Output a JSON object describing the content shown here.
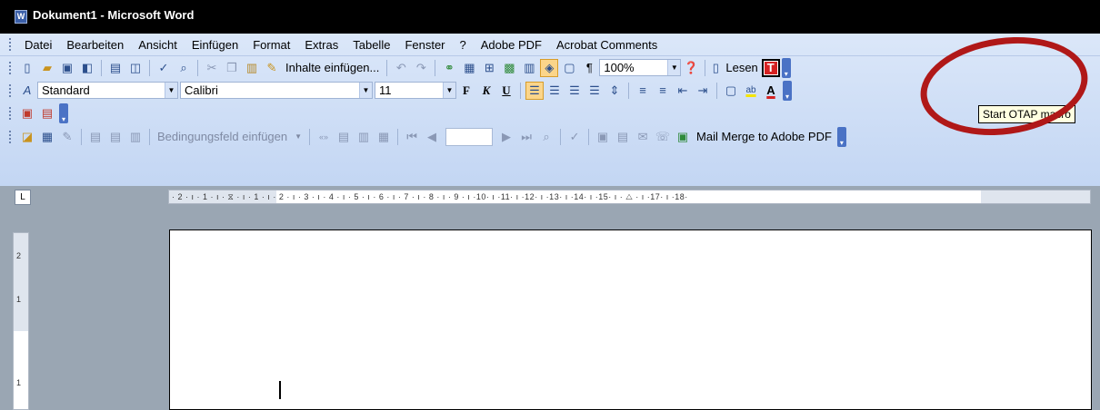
{
  "window": {
    "title": "Dokument1 - Microsoft Word",
    "icon": "word-doc-icon"
  },
  "menu": [
    "Datei",
    "Bearbeiten",
    "Ansicht",
    "Einfügen",
    "Format",
    "Extras",
    "Tabelle",
    "Fenster",
    "?",
    "Adobe PDF",
    "Acrobat Comments"
  ],
  "standard_toolbar": {
    "paste_special_label": "Inhalte einfügen...",
    "zoom_value": "100%",
    "read_label": "Lesen",
    "start_macro_icon": "T"
  },
  "formatting_toolbar": {
    "style_value": "Standard",
    "font_value": "Calibri",
    "size_value": "11",
    "bold": "F",
    "italic": "K",
    "underline": "U",
    "highlight_label": "ab",
    "font_color_label": "A"
  },
  "mailmerge_toolbar": {
    "insert_condition_label": "Bedingungsfeld einfügen",
    "mail_merge_pdf_label": "Mail Merge to Adobe PDF"
  },
  "tooltip": {
    "text": "Start OTAP macro"
  },
  "ruler": {
    "corner_label": "L",
    "horizontal_text": "· 2 · ı · 1 · ı ·  ⧖  · ı · 1 · ı · 2 · ı · 3 · ı · 4 · ı · 5 · ı · 6 · ı · 7 · ı · 8 · ı · 9 · ı ·10· ı ·11· ı ·12· ı ·13· ı ·14· ı ·15· ı · △ · ı ·17· ı ·18·",
    "vertical_labels": [
      "2",
      "1"
    ]
  },
  "colors": {
    "accent": "#316ac5",
    "callout": "#b01818",
    "titlebar": "#000000"
  }
}
